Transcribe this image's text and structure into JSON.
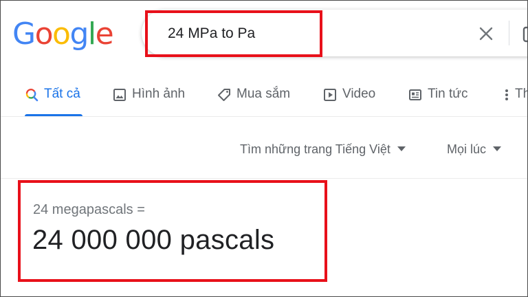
{
  "logo": {
    "text": "Google",
    "letters": [
      "G",
      "o",
      "o",
      "g",
      "l",
      "e"
    ]
  },
  "search": {
    "query": "24 MPa to Pa"
  },
  "tabs": [
    {
      "label": "Tất cả",
      "icon": "search-icon",
      "active": true
    },
    {
      "label": "Hình ảnh",
      "icon": "image-icon",
      "active": false
    },
    {
      "label": "Mua sắm",
      "icon": "tag-icon",
      "active": false
    },
    {
      "label": "Video",
      "icon": "play-icon",
      "active": false
    },
    {
      "label": "Tin tức",
      "icon": "news-icon",
      "active": false
    },
    {
      "label": "Th",
      "icon": "more-icon",
      "active": false
    }
  ],
  "filters": {
    "language": "Tìm những trang Tiếng Việt",
    "time": "Mọi lúc"
  },
  "answer": {
    "equation": "24 megapascals =",
    "result": "24 000 000 pascals"
  },
  "colors": {
    "accent": "#1a73e8",
    "highlight": "#e8101a",
    "logo_blue": "#4285f4",
    "logo_red": "#ea4335",
    "logo_yellow": "#fbbc05",
    "logo_green": "#34a853"
  }
}
